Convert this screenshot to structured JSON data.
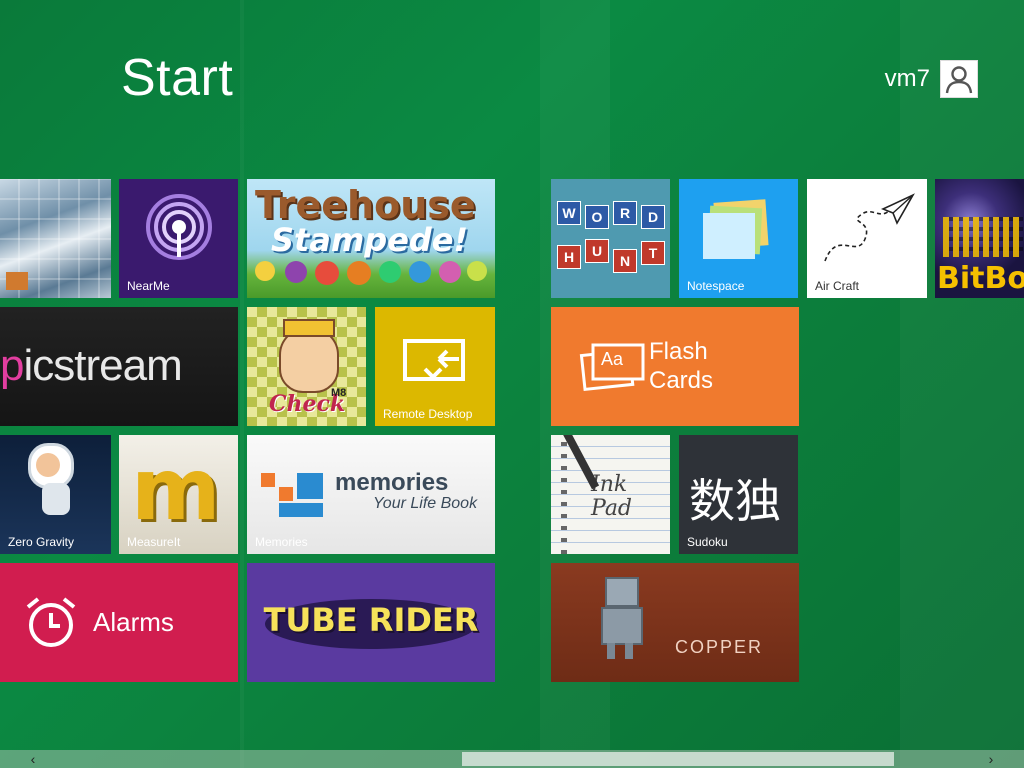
{
  "screen": {
    "title": "Start",
    "user_name": "vm7",
    "accent_color": "#0b8a43"
  },
  "tiles": {
    "nearme": "NearMe",
    "treehouse_line1": "Treehouse",
    "treehouse_line2": "Stampede!",
    "word_hunt_letters": [
      "W",
      "O",
      "R",
      "D",
      "H",
      "U",
      "N",
      "T"
    ],
    "notespace": "Notespace",
    "aircraft": "Air Craft",
    "bitbox": "BitBo",
    "picstream": "picstream",
    "checkm8": "Check",
    "checkm8_suffix": "M8",
    "remote_desktop": "Remote Desktop",
    "flash_cards_line1": "Flash",
    "flash_cards_line2": "Cards",
    "flash_cards_icon_text": "Aa",
    "zero_gravity": "Zero Gravity",
    "measureit": "MeasureIt",
    "memories_title": "memories",
    "memories_subtitle": "Your Life Book",
    "memories_label": "Memories",
    "inkpad": "Ink Pad",
    "sudoku_glyph": "数独",
    "sudoku": "Sudoku",
    "alarms": "Alarms",
    "tube_rider": "TUBE RIDER",
    "copper": "COPPER"
  },
  "icons": {
    "user": "user-avatar-icon",
    "nearme": "radio-signal-icon",
    "remote_desktop": "remote-desktop-icon",
    "flash_cards": "cards-icon",
    "alarms": "alarm-clock-icon",
    "scroll_left": "chevron-left-icon",
    "scroll_right": "chevron-right-icon"
  },
  "scrollbar": {
    "left_arrow": "‹",
    "right_arrow": "›"
  }
}
